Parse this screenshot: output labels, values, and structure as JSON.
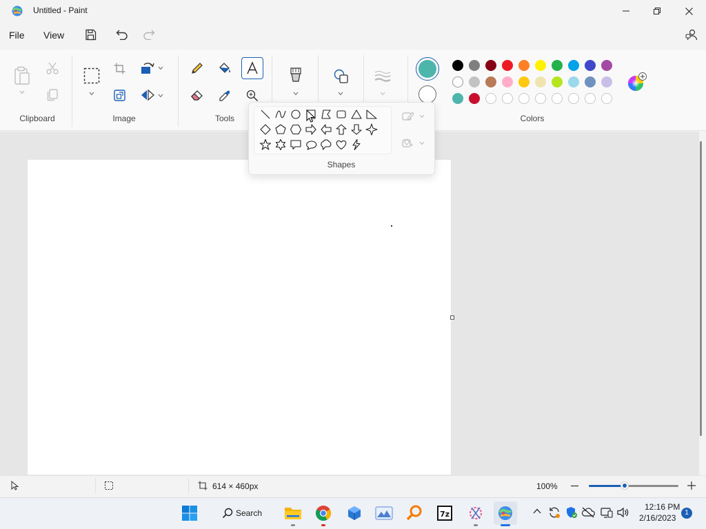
{
  "window": {
    "title": "Untitled - Paint"
  },
  "menu": {
    "file": "File",
    "view": "View"
  },
  "ribbon": {
    "groups": {
      "clipboard": "Clipboard",
      "image": "Image",
      "tools": "Tools",
      "shapes": "Shapes",
      "colors": "Colors"
    },
    "active_color1": "#4db6ac",
    "active_color2": "#ffffff"
  },
  "palette": {
    "row1": [
      "#000000",
      "#7f7f7f",
      "#880015",
      "#ed1c24",
      "#ff7f27",
      "#fff200",
      "#22b14c",
      "#00a2e8",
      "#3f48cc",
      "#a349a4"
    ],
    "row2": [
      "#ffffff",
      "#c3c3c3",
      "#b97a57",
      "#ffaec9",
      "#ffc90e",
      "#efe4b0",
      "#b5e61d",
      "#99d9ea",
      "#7092be",
      "#c8bfe7"
    ],
    "row3": [
      "#4db6ac",
      "#c8102e",
      "",
      "",
      "",
      "",
      "",
      "",
      "",
      ""
    ]
  },
  "status": {
    "dimensions": "614 × 460px",
    "zoom": "100%",
    "zoom_fraction": 0.4
  },
  "taskbar": {
    "search": "Search",
    "time": "12:16 PM",
    "date": "2/16/2023",
    "notifications": "1"
  }
}
